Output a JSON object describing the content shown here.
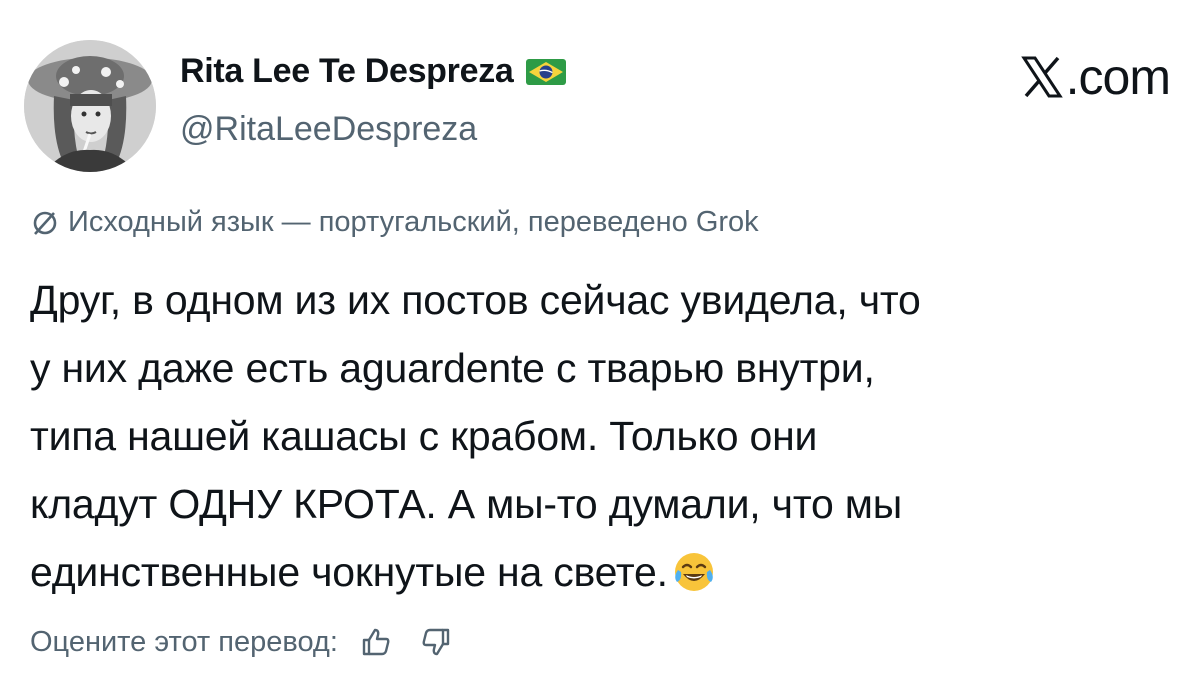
{
  "author": {
    "display_name": "Rita Lee Te Despreza",
    "handle": "@RitaLeeDespreza",
    "flag_icon": "brazil-flag-icon",
    "avatar_icon": "avatar-photo"
  },
  "brand": {
    "text": ".com",
    "icon": "x-logo-icon"
  },
  "translation": {
    "icon": "globe-slash-icon",
    "note": "Исходный язык — португальский, переведено Grok"
  },
  "tweet": {
    "lines": [
      "Друг, в одном из их постов сейчас увидела, что",
      "у них даже есть aguardente с тварью внутри,",
      "типа нашей кашасы с крабом. Только они",
      "кладут ОДНУ КРОТА. А мы-то думали, что мы",
      "единственные чокнутые на свете."
    ],
    "emoji": "face-with-tears-of-joy-icon"
  },
  "rating": {
    "label": "Оцените этот перевод:",
    "up_icon": "thumbs-up-icon",
    "down_icon": "thumbs-down-icon"
  },
  "colors": {
    "text_primary": "#0f1419",
    "text_secondary": "#536471"
  }
}
